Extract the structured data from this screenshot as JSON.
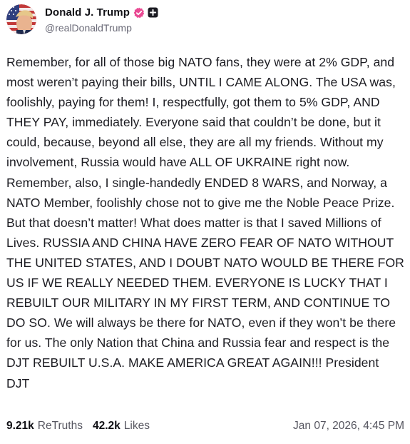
{
  "author": {
    "display_name": "Donald J. Trump",
    "handle": "@realDonaldTrump",
    "badge_verified_icon": "verified-check-icon",
    "badge_plus_icon": "plus-badge-icon",
    "verified_color": "#e94a93"
  },
  "post": {
    "text": "Remember, for all of those big NATO fans, they were at 2% GDP, and most weren’t paying their bills, UNTIL I CAME ALONG. The USA was, foolishly, paying for them! I, respectfully, got them to 5% GDP, AND THEY PAY, immediately. Everyone said that couldn’t be done, but it could, because, beyond all else, they are all my friends. Without my involvement, Russia would have ALL OF UKRAINE right now. Remember, also, I single-handedly ENDED 8 WARS, and Norway, a NATO Member, foolishly chose not to give me the Noble Peace Prize. But that doesn’t matter! What does matter is that I saved Millions of Lives. RUSSIA AND CHINA HAVE ZERO FEAR OF NATO WITHOUT THE UNITED STATES, AND I DOUBT NATO WOULD BE THERE FOR US IF WE REALLY NEEDED THEM. EVERYONE IS LUCKY THAT I REBUILT OUR MILITARY IN MY FIRST TERM, AND CONTINUE TO DO SO. We will always be there for NATO, even if they won’t be there for us. The only Nation that China and Russia fear and respect is the DJT REBUILT U.S.A. MAKE AMERICA GREAT AGAIN!!! President DJT"
  },
  "stats": {
    "retruths_count": "9.21k",
    "retruths_label": "ReTruths",
    "likes_count": "42.2k",
    "likes_label": "Likes",
    "timestamp": "Jan 07, 2026, 4:45 PM"
  }
}
